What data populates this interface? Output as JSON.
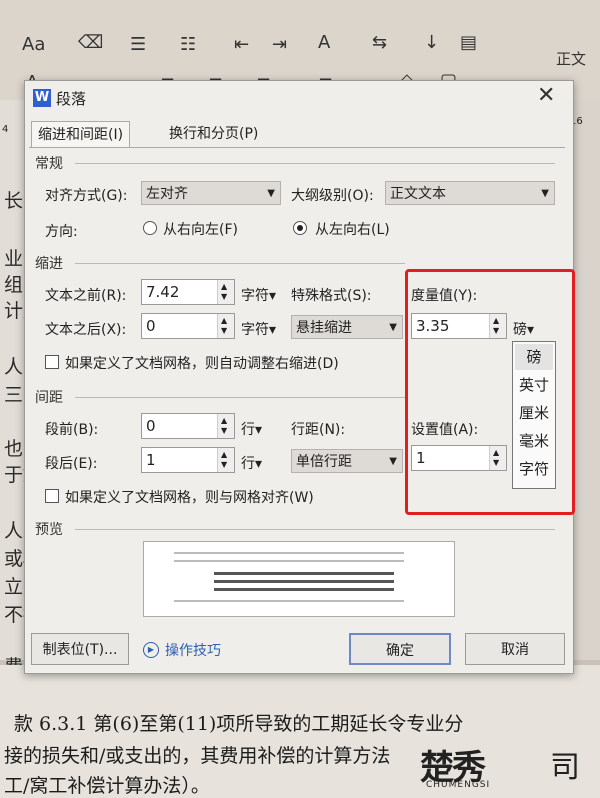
{
  "background": {
    "ribbon_style_label": "正文",
    "ruler_marks": [
      "4",
      "16"
    ],
    "doc_lines": [
      "款 6.3.1 第(6)至第(11)项所导致的工期延长令专业分",
      "接的损失和/或支出的，其费用补偿的计算方法",
      "工/窝工补偿计算办法）。"
    ],
    "left_glyphs": [
      "长自",
      "业分",
      "组主",
      "计监",
      "人因",
      "三(",
      "也几",
      "于婉",
      "人未",
      "或权",
      "立当",
      "不损",
      "费用"
    ]
  },
  "dialog": {
    "title": "段落",
    "logo": "W",
    "tabs": [
      {
        "label": "缩进和间距(I)",
        "active": true
      },
      {
        "label": "换行和分页(P)",
        "active": false
      }
    ],
    "general": {
      "section_label": "常规",
      "alignment_label": "对齐方式(G):",
      "alignment_value": "左对齐",
      "outline_label": "大纲级别(O):",
      "outline_value": "正文文本",
      "direction_label": "方向:",
      "direction_options": [
        {
          "label": "从右向左(F)",
          "selected": false
        },
        {
          "label": "从左向右(L)",
          "selected": true
        }
      ]
    },
    "indent": {
      "section_label": "缩进",
      "before_label": "文本之前(R):",
      "before_value": "7.42",
      "before_unit": "字符",
      "after_label": "文本之后(X):",
      "after_value": "0",
      "after_unit": "字符",
      "special_label": "特殊格式(S):",
      "special_value": "悬挂缩进",
      "measure_label": "度量值(Y):",
      "measure_value": "3.35",
      "measure_unit": "磅",
      "grid_checkbox_label": "如果定义了文档网格，则自动调整右缩进(D)",
      "unit_options": [
        {
          "label": "磅",
          "selected": true
        },
        {
          "label": "英寸",
          "selected": false
        },
        {
          "label": "厘米",
          "selected": false
        },
        {
          "label": "毫米",
          "selected": false
        },
        {
          "label": "字符",
          "selected": false
        }
      ]
    },
    "spacing": {
      "section_label": "间距",
      "before_label": "段前(B):",
      "before_value": "0",
      "before_unit": "行",
      "after_label": "段后(E):",
      "after_value": "1",
      "after_unit": "行",
      "line_label": "行距(N):",
      "line_value": "单倍行距",
      "setting_label": "设置值(A):",
      "setting_value": "1",
      "grid_checkbox_label": "如果定义了文档网格，则与网格对齐(W)"
    },
    "preview": {
      "section_label": "预览"
    },
    "buttons": {
      "tabs_label": "制表位(T)...",
      "tips_label": "操作技巧",
      "ok_label": "确定",
      "cancel_label": "取消"
    },
    "highlight_color": "#e02020"
  },
  "watermark": {
    "logo_text": "楚秀",
    "brand": "CHUMENGSI"
  }
}
